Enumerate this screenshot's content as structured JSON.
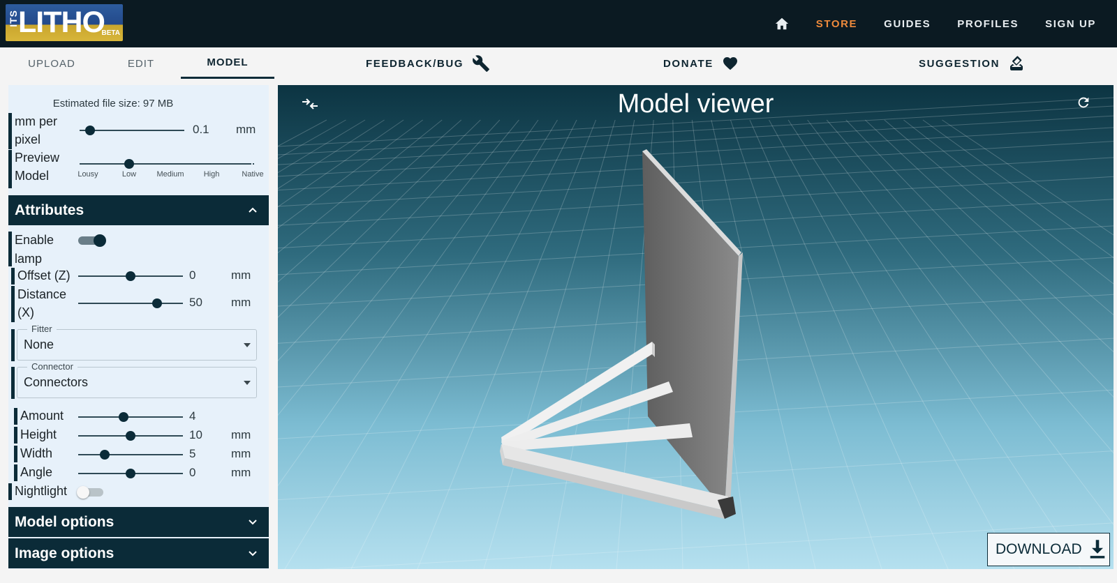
{
  "header": {
    "logo": {
      "its": "ITS",
      "main": "LITHO",
      "badge": "BETA"
    },
    "nav": {
      "home_icon": "home-icon",
      "store": "STORE",
      "guides": "GUIDES",
      "profiles": "PROFILES",
      "signup": "SIGN UP"
    },
    "colors": {
      "bar": "#0b1a22",
      "store": "#ee8a3c"
    }
  },
  "tabs": {
    "upload": "UPLOAD",
    "edit": "EDIT",
    "model": "MODEL",
    "active": "MODEL"
  },
  "actions": {
    "feedback": "FEEDBACK/BUG",
    "donate": "DONATE",
    "suggestion": "SUGGESTION"
  },
  "panel": {
    "est_size": "Estimated file size: 97 MB",
    "mm_per_pixel": {
      "label_1": "mm per",
      "label_2": "pixel",
      "value": "0.1",
      "unit": "mm",
      "fraction": 0.1
    },
    "preview": {
      "label_1": "Preview",
      "label_2": "Model",
      "ticks": [
        "Lousy",
        "Low",
        "Medium",
        "High",
        "Native"
      ],
      "selected": "Low"
    },
    "attributes": {
      "title": "Attributes",
      "enable_lamp": {
        "label_1": "Enable",
        "label_2": "lamp",
        "on": true
      },
      "offset": {
        "label": "Offset (Z)",
        "value": "0",
        "unit": "mm",
        "fraction": 0.5
      },
      "distance": {
        "label_1": "Distance",
        "label_2": "(X)",
        "value": "50",
        "unit": "mm",
        "fraction": 0.75
      },
      "fitter": {
        "legend": "Fitter",
        "value": "None"
      },
      "connector": {
        "legend": "Connector",
        "value": "Connectors"
      },
      "amount": {
        "label": "Amount",
        "value": "4",
        "unit": "",
        "fraction": 0.43
      },
      "height": {
        "label": "Height",
        "value": "10",
        "unit": "mm",
        "fraction": 0.5
      },
      "width": {
        "label": "Width",
        "value": "5",
        "unit": "mm",
        "fraction": 0.25
      },
      "angle": {
        "label": "Angle",
        "value": "0",
        "unit": "mm",
        "fraction": 0.5
      },
      "nightlight": {
        "label": "Nightlight",
        "on": false
      }
    },
    "model_options": "Model options",
    "image_options": "Image options",
    "colors": {
      "bg": "#e7f1fa",
      "accent": "#0b2b38"
    }
  },
  "viewer": {
    "title": "Model viewer",
    "download": "DOWNLOAD",
    "icons": [
      "collapse-icon",
      "refresh-icon",
      "download-icon"
    ],
    "colors": {
      "top": "#0c3442",
      "bottom": "#a5d6e8",
      "grid": "#ffffff"
    }
  }
}
